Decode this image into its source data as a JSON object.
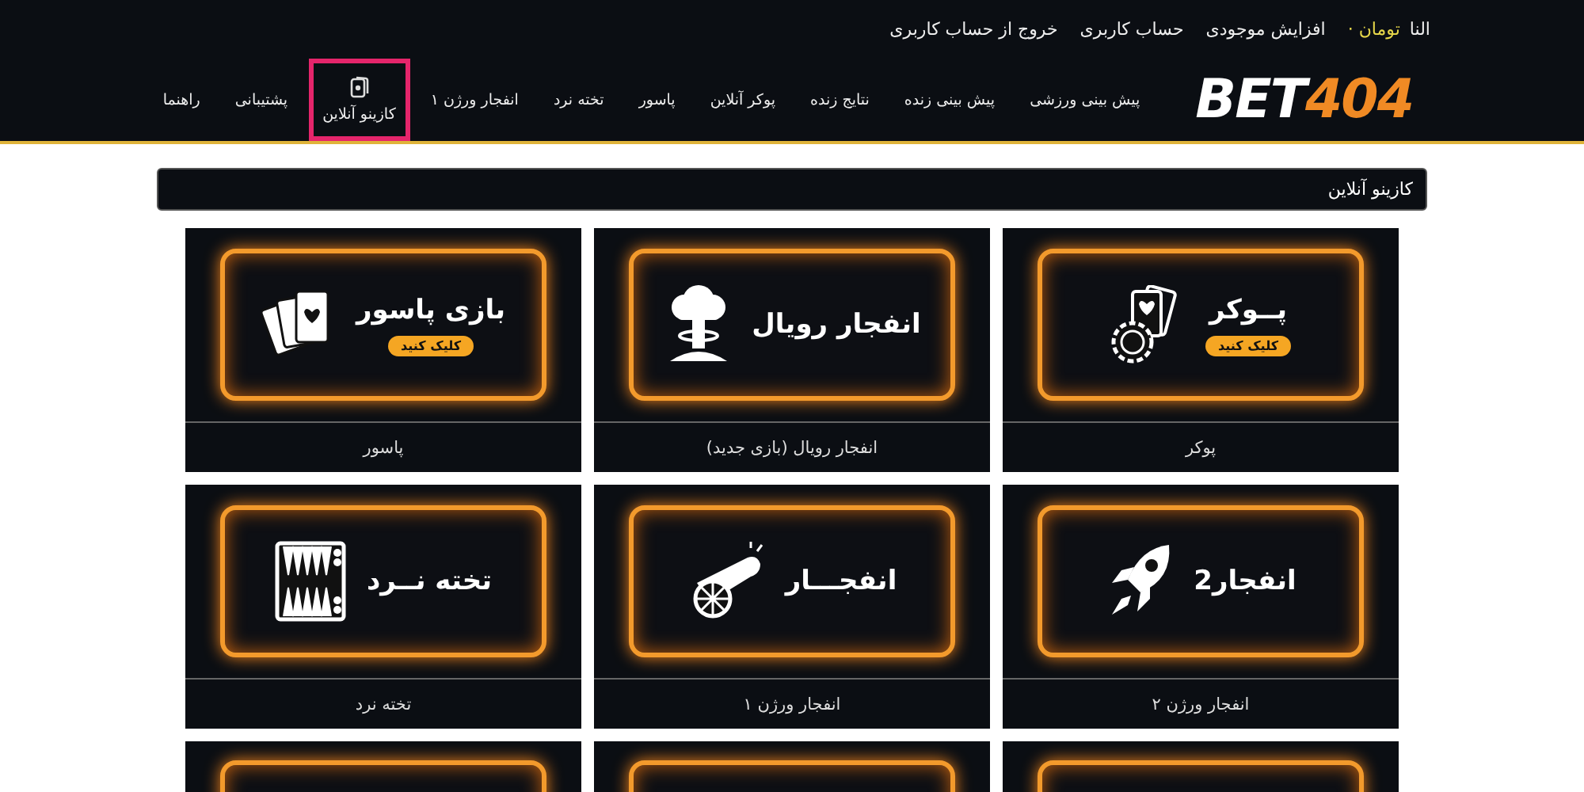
{
  "account_bar": {
    "username": "النا",
    "balance": "تومان ·",
    "links": [
      "افزایش موجودی",
      "حساب کاربری",
      "خروج از حساب کاربری"
    ]
  },
  "logo": {
    "part_1": "BET",
    "part_2": "404"
  },
  "nav": [
    {
      "label": "پیش بینی ورزشی",
      "selected": false
    },
    {
      "label": "پیش بینی زنده",
      "selected": false
    },
    {
      "label": "نتایج زنده",
      "selected": false
    },
    {
      "label": "پوکر آنلاین",
      "selected": false
    },
    {
      "label": "پاسور",
      "selected": false
    },
    {
      "label": "تخته نرد",
      "selected": false
    },
    {
      "label": "انفجار ورژن ۱",
      "selected": false
    },
    {
      "label": "کازینو آنلاین",
      "selected": true,
      "kind": "with-icon"
    },
    {
      "label": "پشتیبانی",
      "selected": false
    },
    {
      "label": "راهنما",
      "selected": false
    }
  ],
  "section": {
    "title": "کازینو آنلاین"
  },
  "games": [
    {
      "name": "پوکر",
      "banner": {
        "title": "پــوکر",
        "cta": "کلیک کنید",
        "kind": "poker"
      }
    },
    {
      "name": "انفجار رویال (بازی جدید)",
      "banner": {
        "title": "انفجار رویال",
        "kind": "royal-crash"
      }
    },
    {
      "name": "پاسور",
      "banner": {
        "title": "بازی پاسور",
        "cta": "کلیک کنید",
        "kind": "pasur"
      }
    },
    {
      "name": "انفجار ورژن ۲",
      "banner": {
        "title": "انفجار2",
        "kind": "crash-2"
      }
    },
    {
      "name": "انفجار ورژن ۱",
      "banner": {
        "title": "انفجـــار",
        "kind": "crash-1"
      }
    },
    {
      "name": "تخته نرد",
      "banner": {
        "title": "تخته نــرد",
        "kind": "backgammon"
      }
    },
    {
      "kind": "cut-off"
    },
    {
      "kind": "cut-off"
    },
    {
      "kind": "cut-off"
    }
  ]
}
